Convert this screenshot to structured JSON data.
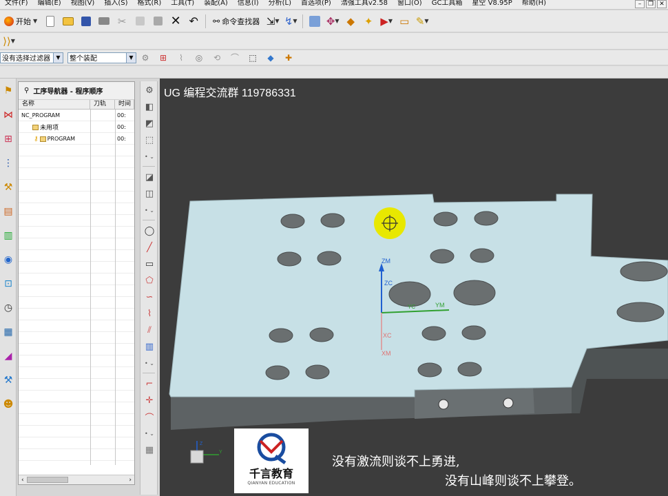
{
  "menu": {
    "items": [
      "文件(F)",
      "编辑(E)",
      "视图(V)",
      "插入(S)",
      "格式(R)",
      "工具(T)",
      "装配(A)",
      "信息(I)",
      "分析(L)",
      "首选项(P)",
      "浩强工具v2.58",
      "窗口(O)",
      "GC工具箱",
      "星空 V8.95P",
      "帮助(H)"
    ]
  },
  "toolbar": {
    "start_label": "开始",
    "command_finder_label": "命令查找器"
  },
  "selection_bar": {
    "filter_value": "没有选择过滤器",
    "scope_value": "整个装配"
  },
  "navigator": {
    "title": "工序导航器 - 程序顺序",
    "columns": [
      "名称",
      "刀轨",
      "时间"
    ],
    "rows": [
      {
        "name": "NC_PROGRAM",
        "toolpath": "",
        "time": "00:"
      },
      {
        "name": "未用项",
        "toolpath": "",
        "time": "00:"
      },
      {
        "name": "PROGRAM",
        "toolpath": "",
        "time": "00:"
      }
    ]
  },
  "viewport": {
    "title": "UG 编程交流群 119786331",
    "axis_labels": {
      "zm": "ZM",
      "zc": "ZC",
      "xc": "XC",
      "ym": "YM",
      "xm": "XM",
      "yc": "YC"
    },
    "triad_labels": {
      "z": "Z",
      "y": "Y"
    },
    "caption_line1": "没有激流则谈不上勇进,",
    "caption_line2": "没有山峰则谈不上攀登。"
  },
  "logo": {
    "main": "千言教育",
    "sub": "QIANYAN EDUCATION"
  },
  "colors": {
    "viewport_bg": "#3c3c3c",
    "part_top": "#c7e0e6",
    "part_side": "#5a5f60",
    "selection_highlight": "#e8e800",
    "axis_z": "#2060d0",
    "axis_y": "#30a030",
    "axis_x": "#d04040"
  }
}
